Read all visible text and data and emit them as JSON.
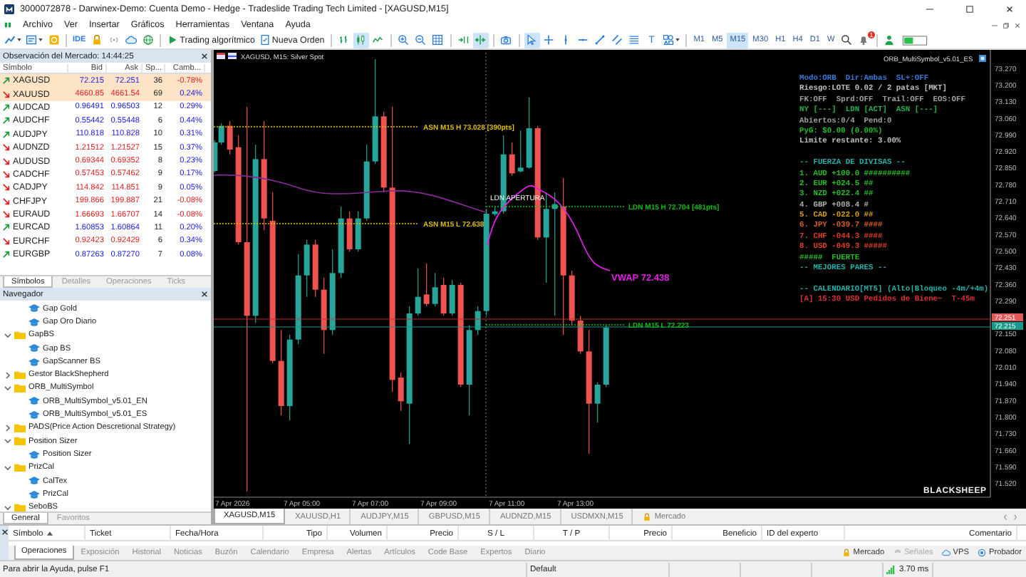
{
  "title_bar": {
    "title": "3000072878 - Darwinex-Demo: Cuenta Demo - Hedge - Tradeslide Trading Tech Limited - [XAGUSD,M15]"
  },
  "menu": [
    "Archivo",
    "Ver",
    "Insertar",
    "Gráficos",
    "Herramientas",
    "Ventana",
    "Ayuda"
  ],
  "toolbar": {
    "groups": [
      [
        {
          "kind": "chart-type",
          "selected": false
        },
        {
          "kind": "template",
          "selected": false
        },
        {
          "kind": "coin",
          "selected": false
        }
      ],
      [
        {
          "kind": "ide",
          "label": "IDE",
          "selected": false
        },
        {
          "kind": "lock",
          "selected": false
        },
        {
          "kind": "broadcast",
          "selected": false
        },
        {
          "kind": "cloud",
          "selected": false
        },
        {
          "kind": "globe",
          "selected": false
        }
      ],
      [
        {
          "kind": "algo",
          "label": "Trading algorítmico",
          "selected": false
        },
        {
          "kind": "order",
          "label": "Nueva Orden",
          "selected": false
        }
      ],
      [
        {
          "kind": "bars",
          "selected": false
        },
        {
          "kind": "candles",
          "selected": true
        },
        {
          "kind": "line",
          "selected": false
        }
      ],
      [
        {
          "kind": "zoom-in",
          "selected": false
        },
        {
          "kind": "zoom-out",
          "selected": false
        },
        {
          "kind": "grid",
          "selected": false
        }
      ],
      [
        {
          "kind": "scroll",
          "selected": false
        },
        {
          "kind": "shift",
          "selected": true
        }
      ],
      [
        {
          "kind": "camera",
          "selected": false
        }
      ],
      [
        {
          "kind": "cursor",
          "selected": true
        },
        {
          "kind": "crosshair",
          "selected": false
        },
        {
          "kind": "vline",
          "selected": false
        },
        {
          "kind": "hline",
          "selected": false
        },
        {
          "kind": "trendline",
          "selected": false
        },
        {
          "kind": "channel",
          "selected": false
        },
        {
          "kind": "fibo",
          "selected": false
        },
        {
          "kind": "text",
          "label": "T",
          "selected": false
        },
        {
          "kind": "shapes",
          "selected": false
        }
      ]
    ],
    "timeframes": [
      {
        "label": "M1",
        "selected": false
      },
      {
        "label": "M5",
        "selected": false
      },
      {
        "label": "M15",
        "selected": true
      },
      {
        "label": "M30",
        "selected": false
      },
      {
        "label": "H1",
        "selected": false
      },
      {
        "label": "H4",
        "selected": false
      },
      {
        "label": "D1",
        "selected": false
      },
      {
        "label": "W",
        "selected": false
      }
    ],
    "notification_count": "1"
  },
  "market_watch": {
    "title": "Observación del Mercado: 14:44:25",
    "columns": [
      "Símbolo",
      "Bid",
      "Ask",
      "Sp...",
      "Camb..."
    ],
    "rows": [
      {
        "symbol": "XAGUSD",
        "bid": "72.215",
        "ask": "72.251",
        "spread": "36",
        "change": "-0.78%",
        "rising": true,
        "change_negative": true,
        "highlighted": true
      },
      {
        "symbol": "XAUUSD",
        "bid": "4660.85",
        "ask": "4661.54",
        "spread": "69",
        "change": "0.24%",
        "rising": false,
        "change_negative": false,
        "highlighted": true
      },
      {
        "symbol": "AUDCAD",
        "bid": "0.96491",
        "ask": "0.96503",
        "spread": "12",
        "change": "0.29%",
        "rising": true,
        "change_negative": false,
        "highlighted": false
      },
      {
        "symbol": "AUDCHF",
        "bid": "0.55442",
        "ask": "0.55448",
        "spread": "6",
        "change": "0.44%",
        "rising": true,
        "change_negative": false,
        "highlighted": false
      },
      {
        "symbol": "AUDJPY",
        "bid": "110.818",
        "ask": "110.828",
        "spread": "10",
        "change": "0.31%",
        "rising": true,
        "change_negative": false,
        "highlighted": false
      },
      {
        "symbol": "AUDNZD",
        "bid": "1.21512",
        "ask": "1.21527",
        "spread": "15",
        "change": "0.37%",
        "rising": false,
        "change_negative": false,
        "highlighted": false
      },
      {
        "symbol": "AUDUSD",
        "bid": "0.69344",
        "ask": "0.69352",
        "spread": "8",
        "change": "0.23%",
        "rising": false,
        "change_negative": false,
        "highlighted": false
      },
      {
        "symbol": "CADCHF",
        "bid": "0.57453",
        "ask": "0.57462",
        "spread": "9",
        "change": "0.17%",
        "rising": false,
        "change_negative": false,
        "highlighted": false
      },
      {
        "symbol": "CADJPY",
        "bid": "114.842",
        "ask": "114.851",
        "spread": "9",
        "change": "0.05%",
        "rising": false,
        "change_negative": false,
        "highlighted": false
      },
      {
        "symbol": "CHFJPY",
        "bid": "199.866",
        "ask": "199.887",
        "spread": "21",
        "change": "-0.08%",
        "rising": false,
        "change_negative": true,
        "highlighted": false
      },
      {
        "symbol": "EURAUD",
        "bid": "1.66693",
        "ask": "1.66707",
        "spread": "14",
        "change": "-0.08%",
        "rising": false,
        "change_negative": true,
        "highlighted": false
      },
      {
        "symbol": "EURCAD",
        "bid": "1.60853",
        "ask": "1.60864",
        "spread": "11",
        "change": "0.20%",
        "rising": true,
        "change_negative": false,
        "highlighted": false
      },
      {
        "symbol": "EURCHF",
        "bid": "0.92423",
        "ask": "0.92429",
        "spread": "6",
        "change": "0.34%",
        "rising": false,
        "change_negative": false,
        "highlighted": false
      },
      {
        "symbol": "EURGBP",
        "bid": "0.87263",
        "ask": "0.87270",
        "spread": "7",
        "change": "0.08%",
        "rising": true,
        "change_negative": false,
        "highlighted": false
      }
    ],
    "tabs": [
      {
        "label": "Símbolos",
        "selected": true
      },
      {
        "label": "Detalles",
        "selected": false
      },
      {
        "label": "Operaciones",
        "selected": false
      },
      {
        "label": "Ticks",
        "selected": false
      }
    ]
  },
  "navigator": {
    "title": "Navegador",
    "tree": [
      {
        "kind": "group",
        "children": [
          {
            "kind": "expert",
            "label": "Gap Gold"
          },
          {
            "kind": "expert",
            "label": "Gap Oro Diario"
          }
        ]
      },
      {
        "kind": "folder",
        "label": "GapBS",
        "expanded": true,
        "children": [
          {
            "kind": "expert",
            "label": "Gap BS"
          },
          {
            "kind": "expert",
            "label": "GapScanner BS"
          }
        ]
      },
      {
        "kind": "folder",
        "label": "Gestor BlackShepherd",
        "expanded": false
      },
      {
        "kind": "folder",
        "label": "ORB_MultiSymbol",
        "expanded": true,
        "children": [
          {
            "kind": "expert",
            "label": "ORB_MultiSymbol_v5.01_EN"
          },
          {
            "kind": "expert",
            "label": "ORB_MultiSymbol_v5.01_ES"
          }
        ]
      },
      {
        "kind": "folder",
        "label": "PADS(Price Action Descretional Strategy)",
        "expanded": false
      },
      {
        "kind": "folder",
        "label": "Position Sizer",
        "expanded": true,
        "children": [
          {
            "kind": "expert",
            "label": "Position Sizer"
          }
        ]
      },
      {
        "kind": "folder",
        "label": "PrizCal",
        "expanded": true,
        "children": [
          {
            "kind": "expert",
            "label": "CalTex"
          },
          {
            "kind": "expert",
            "label": "PrizCal"
          }
        ]
      },
      {
        "kind": "folder",
        "label": "SeboBS",
        "expanded": true
      }
    ],
    "tabs": [
      {
        "label": "General",
        "selected": true
      },
      {
        "label": "Favoritos",
        "selected": false
      }
    ]
  },
  "chart": {
    "symbol_label": "XAGUSD, M15: Silver Spot",
    "indicator_label": "ORB_MultiSymbol_v5.01_ES",
    "price_axis": [
      "73.270",
      "73.200",
      "73.130",
      "73.060",
      "72.990",
      "72.920",
      "72.850",
      "72.780",
      "72.710",
      "72.640",
      "72.570",
      "72.500",
      "72.430",
      "72.360",
      "72.290",
      "72.150",
      "72.080",
      "72.010",
      "71.940",
      "71.870",
      "71.800",
      "71.730",
      "71.660",
      "71.590",
      "71.520"
    ],
    "time_axis": [
      "7 Apr 2026",
      "7 Apr 05:00",
      "7 Apr 07:00",
      "7 Apr 09:00",
      "7 Apr 11:00",
      "7 Apr 13:00"
    ],
    "levels": [
      {
        "label": "ASN M15 H 73.028 [390pts]",
        "color": "#e0c000"
      },
      {
        "label": "ASN M15 L 72.638",
        "color": "#e0c000"
      },
      {
        "label": "LDN M15 H 72.704 [481pts]",
        "color": "#10c010"
      },
      {
        "label": "LDN M15 L 72.223",
        "color": "#10c010"
      }
    ],
    "session_label": "LDN APERTURA",
    "vwap_label": "VWAP 72.438",
    "ask_tag": "72.251",
    "bid_tag": "72.215",
    "logo": "BLACKSHEEP",
    "info_panel": [
      [
        {
          "text": "Modo:ORB  Dir:Ambas  SL+:OFF",
          "color": "#3c78d8"
        },
        {
          "text": "Riesgo:LOTE 0.02 / 2 patas [MKT]",
          "color": "#c0c0c0"
        },
        {
          "text": "FK:OFF  Sprd:OFF  Trail:OFF  EOS:OFF",
          "color": "#a0a0a0"
        },
        {
          "text": "NY [---]  LDN [ACT]  ASN [---]",
          "color": "#22b14c"
        },
        {
          "text": "Abiertos:0/4  Pend:0",
          "color": "#a0a0a0"
        },
        {
          "text": "PyG: $0.00 (0.00%)",
          "color": "#22c022"
        },
        {
          "text": "Limite restante: 3.00%",
          "color": "#c0c0c0"
        }
      ],
      [
        {
          "text": "-- FUERZA DE DIVISAS --",
          "color": "#20b2aa"
        },
        {
          "text": "1. AUD +100.0 ##########",
          "color": "#22c022"
        },
        {
          "text": "2. EUR +024.5 ##",
          "color": "#22c022"
        },
        {
          "text": "3. NZD +022.4 ##",
          "color": "#22c022"
        },
        {
          "text": "4. GBP +008.4 #",
          "color": "#b0b0b0"
        },
        {
          "text": "5. CAD -022.0 ##",
          "color": "#d4a017"
        },
        {
          "text": "6. JPY -039.7 ####",
          "color": "#e06020"
        },
        {
          "text": "7. CHF -044.3 ####",
          "color": "#e04020"
        },
        {
          "text": "8. USD -049.3 #####",
          "color": "#e04020"
        },
        {
          "text": "#####  FUERTE",
          "color": "#22c022"
        },
        {
          "text": "-- MEJORES PARES --",
          "color": "#20b2aa"
        }
      ],
      [
        {
          "text": "-- CALENDARIO[MT5] (Alto|Bloqueo -4m/+4m)",
          "color": "#20b2aa"
        },
        {
          "text": "[A] 15:30 USD Pedidos de Biene~  T-45m",
          "color": "#e03030"
        }
      ]
    ]
  },
  "chart_tabs": [
    {
      "label": "XAGUSD,M15",
      "selected": true
    },
    {
      "label": "XAUUSD,H1",
      "selected": false
    },
    {
      "label": "AUDJPY,M15",
      "selected": false
    },
    {
      "label": "GBPUSD,M15",
      "selected": false
    },
    {
      "label": "AUDNZD,M15",
      "selected": false
    },
    {
      "label": "USDMXN,M15",
      "selected": false
    }
  ],
  "market_tab": "Mercado",
  "toolbox": {
    "columns": [
      {
        "label": "Símbolo",
        "sorted": true
      },
      {
        "label": "Ticket",
        "sorted": false
      },
      {
        "label": "Fecha/Hora",
        "sorted": false
      },
      {
        "label": "Tipo",
        "sorted": false
      },
      {
        "label": "Volumen",
        "sorted": false
      },
      {
        "label": "Precio",
        "sorted": false
      },
      {
        "label": "S / L",
        "sorted": false
      },
      {
        "label": "T / P",
        "sorted": false
      },
      {
        "label": "Precio",
        "sorted": false
      },
      {
        "label": "Beneficio",
        "sorted": false
      },
      {
        "label": "ID del experto",
        "sorted": false
      },
      {
        "label": "Comentario",
        "sorted": false
      }
    ],
    "tabs": [
      {
        "label": "Operaciones",
        "selected": true
      },
      {
        "label": "Exposición",
        "selected": false
      },
      {
        "label": "Historial",
        "selected": false
      },
      {
        "label": "Noticias",
        "selected": false
      },
      {
        "label": "Buzón",
        "selected": false
      },
      {
        "label": "Calendario",
        "selected": false
      },
      {
        "label": "Empresa",
        "selected": false
      },
      {
        "label": "Alertas",
        "selected": false
      },
      {
        "label": "Artículos",
        "selected": false
      },
      {
        "label": "Code Base",
        "selected": false
      },
      {
        "label": "Expertos",
        "selected": false
      },
      {
        "label": "Diario",
        "selected": false
      }
    ],
    "services": [
      {
        "kind": "market",
        "label": "Mercado",
        "disabled": false
      },
      {
        "kind": "signals",
        "label": "Señales",
        "disabled": true
      },
      {
        "kind": "vps",
        "label": "VPS",
        "disabled": false
      },
      {
        "kind": "tester",
        "label": "Probador",
        "disabled": false
      }
    ]
  },
  "status_bar": {
    "help": "Para abrir la Ayuda, pulse F1",
    "profile": "Default",
    "ping": "3.70 ms"
  }
}
